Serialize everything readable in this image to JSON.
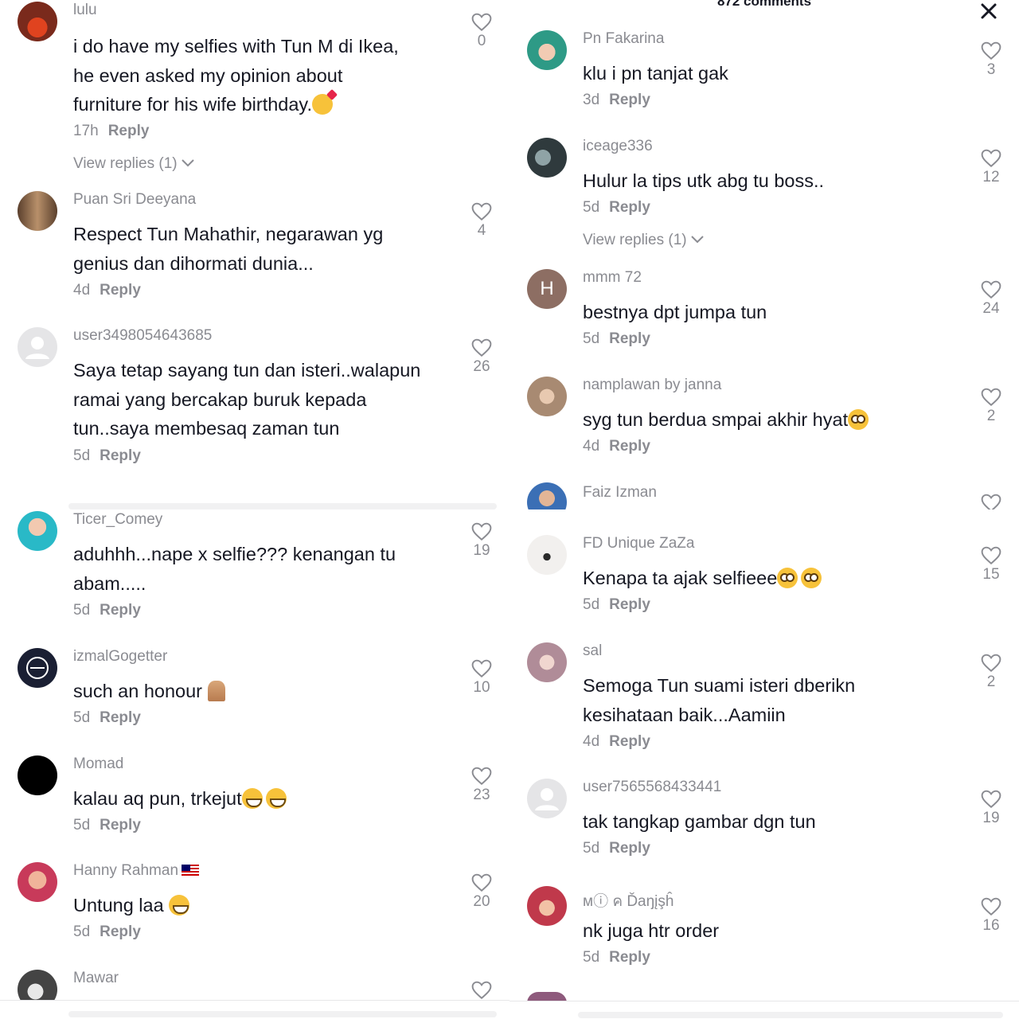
{
  "header": {
    "comment_count": "872 comments"
  },
  "left_top": [
    {
      "user": "lulu",
      "lines": [
        "i do have my selfies with Tun M di Ikea,",
        "he even asked my opinion about",
        "furniture for his wife birthday."
      ],
      "emoji": "love",
      "time": "17h",
      "reply": "Reply",
      "view_replies": "View replies (1)",
      "likes": "0",
      "avatar": "#c44a2a"
    },
    {
      "user": "Puan Sri Deeyana",
      "lines": [
        "Respect Tun Mahathir, negarawan yg",
        "genius dan dihormati dunia..."
      ],
      "time": "4d",
      "reply": "Reply",
      "likes": "4",
      "avatar": "#8b6a4e"
    },
    {
      "user": "user3498054643685",
      "lines": [
        "Saya tetap sayang tun dan isteri..walapun",
        "ramai yang bercakap buruk kepada",
        "tun..saya membesaq zaman tun"
      ],
      "time": "5d",
      "reply": "Reply",
      "likes": "26",
      "avatar": "default"
    }
  ],
  "left_bottom": [
    {
      "user": "Ticer_Comey",
      "lines": [
        "aduhhh...nape x selfie??? kenangan tu",
        "abam....."
      ],
      "time": "5d",
      "reply": "Reply",
      "likes": "19",
      "avatar": "#2ab8c8"
    },
    {
      "user": "izmalGogetter",
      "lines": [
        "such an honour "
      ],
      "emoji": "pray",
      "time": "5d",
      "reply": "Reply",
      "likes": "10",
      "avatar": "#1a1f33"
    },
    {
      "user": "Momad",
      "lines": [
        "kalau aq pun, trkejut"
      ],
      "emoji": "laugh2",
      "time": "5d",
      "reply": "Reply",
      "likes": "23",
      "avatar": "#000000"
    },
    {
      "user": "Hanny Rahman",
      "flag": true,
      "lines": [
        "Untung laa "
      ],
      "emoji": "grin",
      "time": "5d",
      "reply": "Reply",
      "likes": "20",
      "avatar": "#d9627a"
    },
    {
      "user": "Mawar",
      "lines": [],
      "time": "",
      "reply": "",
      "likes": "",
      "avatar": "#555555"
    }
  ],
  "right_top": [
    {
      "user": "Pn Fakarina",
      "lines": [
        "klu i pn tanjat gak"
      ],
      "time": "3d",
      "reply": "Reply",
      "likes": "3",
      "avatar": "#3aa08a"
    },
    {
      "user": "iceage336",
      "lines": [
        "Hulur la tips utk abg tu boss.."
      ],
      "time": "5d",
      "reply": "Reply",
      "view_replies": "View replies (1)",
      "likes": "12",
      "avatar": "#2f3a3d"
    },
    {
      "user": "mmm 72",
      "letter": "H",
      "lines": [
        "bestnya dpt jumpa tun"
      ],
      "time": "5d",
      "reply": "Reply",
      "likes": "24",
      "avatar": "#8d6e63"
    },
    {
      "user": "namplawan by janna",
      "lines": [
        "syg tun berdua smpai akhir hyat"
      ],
      "emoji": "plead",
      "time": "4d",
      "reply": "Reply",
      "likes": "2",
      "avatar": "#b89a84"
    },
    {
      "user": "Faiz Izman",
      "lines": [],
      "time": "",
      "reply": "",
      "likes": "",
      "avatar": "#3b6fb5"
    }
  ],
  "right_bottom": [
    {
      "user": "FD Unique ZaZa",
      "lines": [
        "Kenapa ta ajak selfieee"
      ],
      "emoji": "plead2",
      "time": "5d",
      "reply": "Reply",
      "likes": "15",
      "avatar": "#d8d4d0"
    },
    {
      "user": "sal",
      "lines": [
        "Semoga Tun suami isteri dberikn",
        "kesihataan baik...Aamiin"
      ],
      "time": "4d",
      "reply": "Reply",
      "likes": "2",
      "avatar": "#c9a9b4"
    },
    {
      "user": "user7565568433441",
      "lines": [
        "tak tangkap gambar dgn tun"
      ],
      "time": "5d",
      "reply": "Reply",
      "likes": "19",
      "avatar": "default"
    },
    {
      "user": "ᴍⓘ ค Ďaŋįşĥ",
      "lines": [
        "nk juga htr order"
      ],
      "time": "5d",
      "reply": "Reply",
      "likes": "16",
      "avatar": "#c0394b"
    }
  ]
}
